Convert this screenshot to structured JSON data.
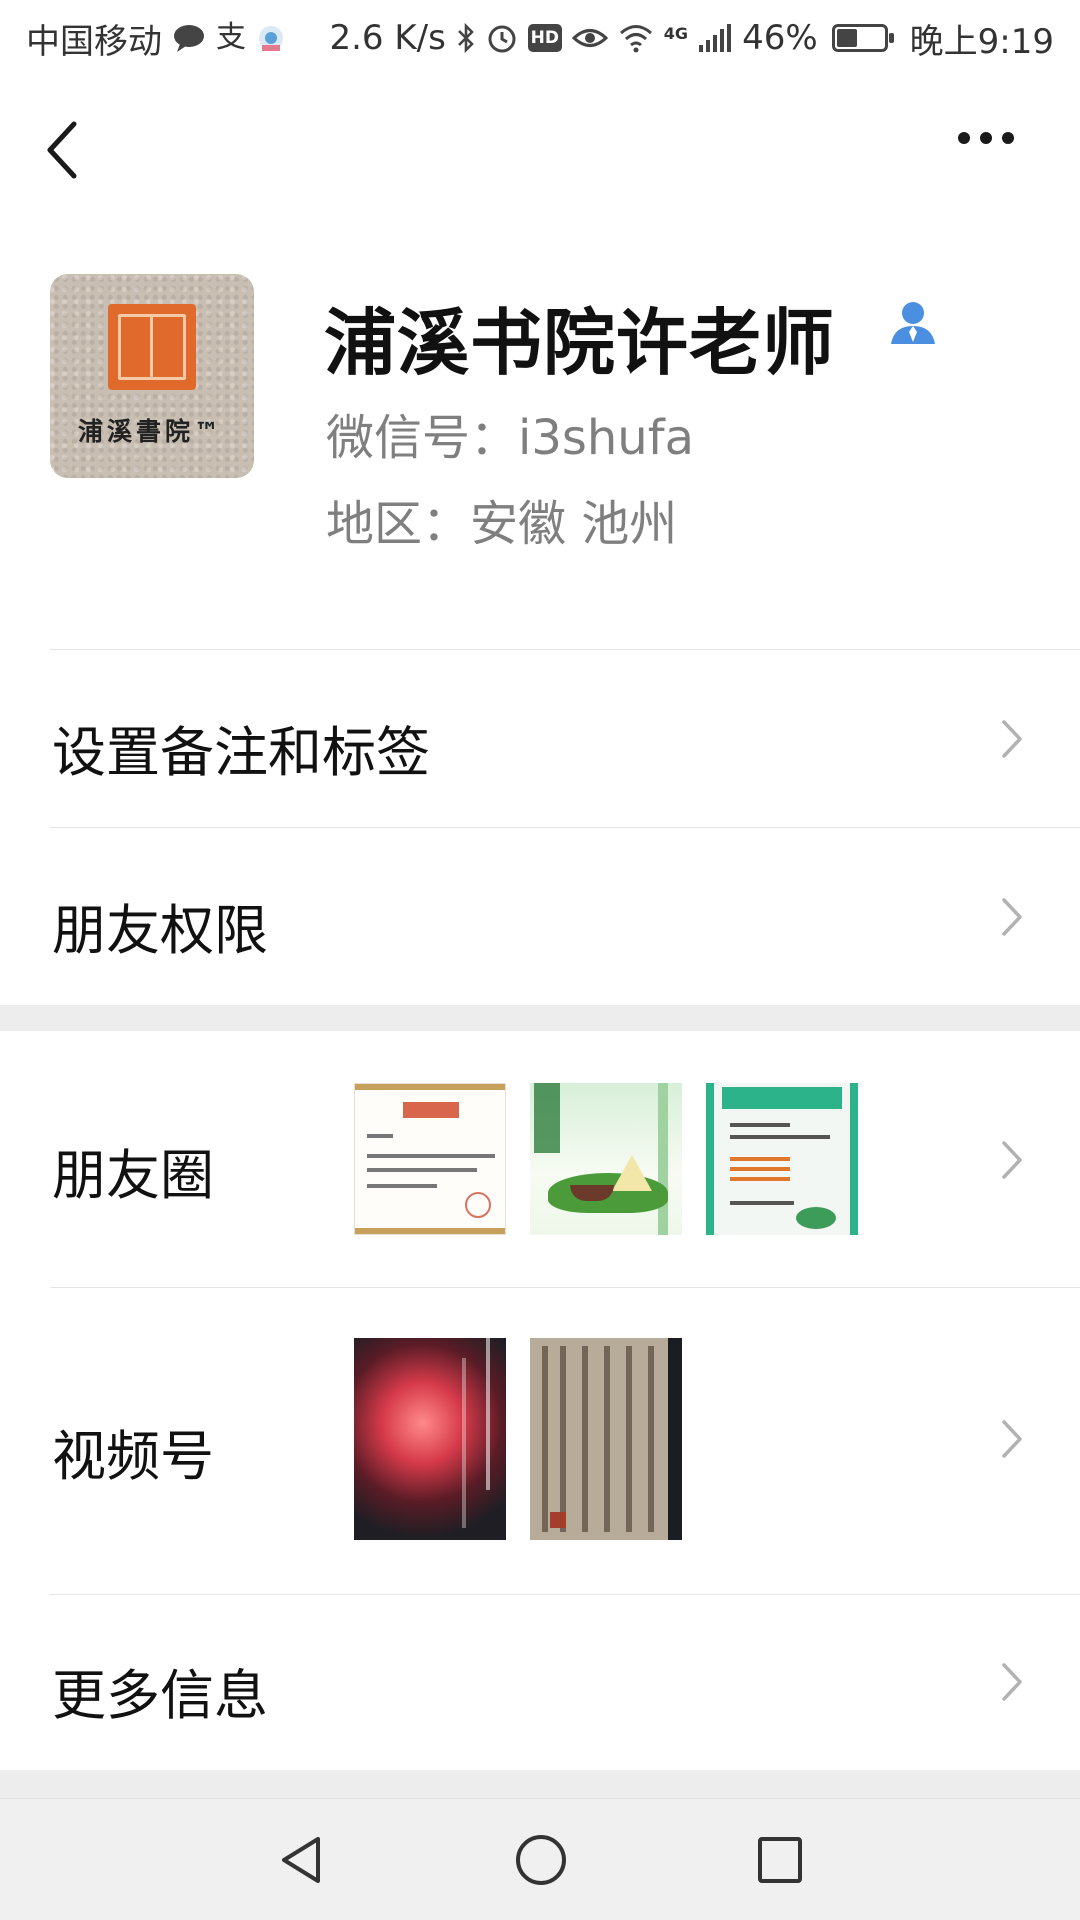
{
  "status_bar": {
    "carrier": "中国移动",
    "speed": "2.6 K/s",
    "hd_badge": "HD",
    "network": "4G",
    "battery_percent": "46%",
    "time": "晚上9:19",
    "icons": [
      "chat-bubble-icon",
      "alipay-icon",
      "app-icon",
      "bluetooth-icon",
      "alarm-icon",
      "eye-icon",
      "wifi-icon",
      "signal-icon",
      "battery-icon"
    ]
  },
  "nav": {
    "back_icon": "back-chevron-icon",
    "more_icon": "more-dots-icon"
  },
  "profile": {
    "avatar_caption": "浦溪書院™",
    "name": "浦溪书院许老师",
    "wechat_id": "微信号：i3shufa",
    "region": "地区：安徽  池州",
    "verified_icon": "person-icon",
    "verified_color": "#4a8fe0"
  },
  "menu": {
    "remark_tags": "设置备注和标签",
    "friend_permissions": "朋友权限",
    "moments": "朋友圈",
    "channels": "视频号",
    "more_info": "更多信息"
  },
  "moments_thumbnails": [
    "certificate-thumbnail",
    "dragon-boat-thumbnail",
    "course-schedule-thumbnail"
  ],
  "channels_thumbnails": [
    "red-glow-video-thumbnail",
    "calligraphy-video-thumbnail"
  ],
  "colors": {
    "accent_blue": "#4a8fe0",
    "divider": "#e6e6e6",
    "section_gap": "#ededed",
    "secondary_text": "#7f7f7f"
  }
}
